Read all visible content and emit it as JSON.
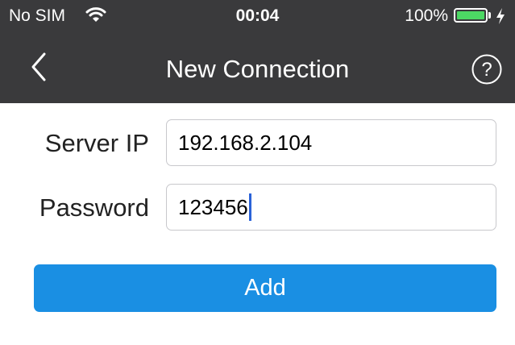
{
  "status_bar": {
    "carrier": "No SIM",
    "time": "00:04",
    "battery_percent": "100%",
    "battery_level": 1.0,
    "battery_color": "#4cd964",
    "charging": true
  },
  "nav": {
    "title": "New Connection",
    "back_icon": "chevron-left-icon",
    "help_icon": "question-circle-icon",
    "background": "#3a3a3c"
  },
  "form": {
    "server_ip": {
      "label": "Server IP",
      "value": "192.168.2.104"
    },
    "password": {
      "label": "Password",
      "value": "123456"
    }
  },
  "actions": {
    "add_label": "Add",
    "add_color": "#1a8fe3"
  }
}
